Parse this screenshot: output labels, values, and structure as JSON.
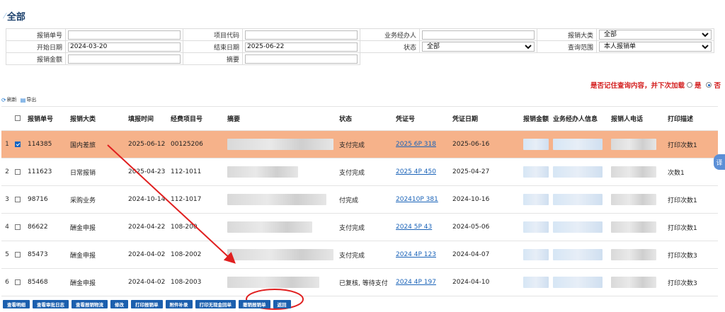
{
  "page": {
    "title": "全部"
  },
  "filters": {
    "row1": {
      "expense_no_label": "报销单号",
      "expense_no_value": "",
      "project_code_label": "项目代码",
      "project_code_value": "",
      "handler_label": "业务经办人",
      "handler_value": "",
      "category_label": "报销大类",
      "category_value": "全部"
    },
    "row2": {
      "start_date_label": "开始日期",
      "start_date_value": "2024-03-20",
      "end_date_label": "结束日期",
      "end_date_value": "2025-06-22",
      "status_label": "状态",
      "status_value": "全部",
      "scope_label": "查询范围",
      "scope_value": "本人报销单"
    },
    "row3": {
      "amount_label": "报销金额",
      "amount_value": "",
      "summary_label": "摘要",
      "summary_value": ""
    }
  },
  "remember": {
    "text": "是否记住查询内容，并下次加载",
    "yes": "是",
    "no": "否",
    "selected": "否"
  },
  "toolbar": {
    "refresh": "刷新",
    "export": "导出"
  },
  "grid": {
    "columns": [
      "报销单号",
      "报销大类",
      "填报时间",
      "经费项目号",
      "摘要",
      "状态",
      "凭证号",
      "凭证日期",
      "报销金额",
      "业务经办人信息",
      "报销人电话",
      "打印描述"
    ],
    "rows": [
      {
        "index": "1",
        "checked": true,
        "no": "114385",
        "category": "国内差旅",
        "date": "2025-06-12",
        "project": "00125206",
        "status": "支付完成",
        "voucher": "2025 6P   318",
        "voucher_date": "2025-06-16",
        "print": "打印次数1"
      },
      {
        "index": "2",
        "checked": false,
        "no": "111623",
        "category": "日常报销",
        "date": "2025-04-23",
        "project": "112-1011",
        "status": "支付完成",
        "voucher": "2025 4P   450",
        "voucher_date": "2025-04-27",
        "print": "次数1"
      },
      {
        "index": "3",
        "checked": false,
        "no": "98716",
        "category": "采购业务",
        "date": "2024-10-14",
        "project": "112-1017",
        "status": "付完成",
        "voucher": "202410P   381",
        "voucher_date": "2024-10-16",
        "print": "打印次数1"
      },
      {
        "index": "4",
        "checked": false,
        "no": "86622",
        "category": "酬金申报",
        "date": "2024-04-22",
        "project": "108-200",
        "status": "支付完成",
        "voucher": "2024 5P   43",
        "voucher_date": "2024-05-06",
        "print": "打印次数1"
      },
      {
        "index": "5",
        "checked": false,
        "no": "85473",
        "category": "酬金申报",
        "date": "2024-04-02",
        "project": "108-2002",
        "status": "支付完成",
        "voucher": "2024 4P   123",
        "voucher_date": "2024-04-07",
        "print": "打印次数3"
      },
      {
        "index": "6",
        "checked": false,
        "no": "85468",
        "category": "酬金申报",
        "date": "2024-04-02",
        "project": "108-2003",
        "status": "已复核, 等待支付",
        "voucher": "2024 4P   197",
        "voucher_date": "2024-04-10",
        "print": "打印次数3"
      }
    ]
  },
  "side_tab": "译",
  "buttons": [
    "查看明细",
    "查看审批日志",
    "查看报销物流",
    "修改",
    "打印报销单",
    "附件补录",
    "打印无现金回单",
    "撤销报销单",
    "返回"
  ],
  "colors": {
    "selected_row": "#f6b28a",
    "button_bg": "#1b5fae",
    "annotation_red": "#e02020",
    "link_blue": "#1a63b8"
  }
}
